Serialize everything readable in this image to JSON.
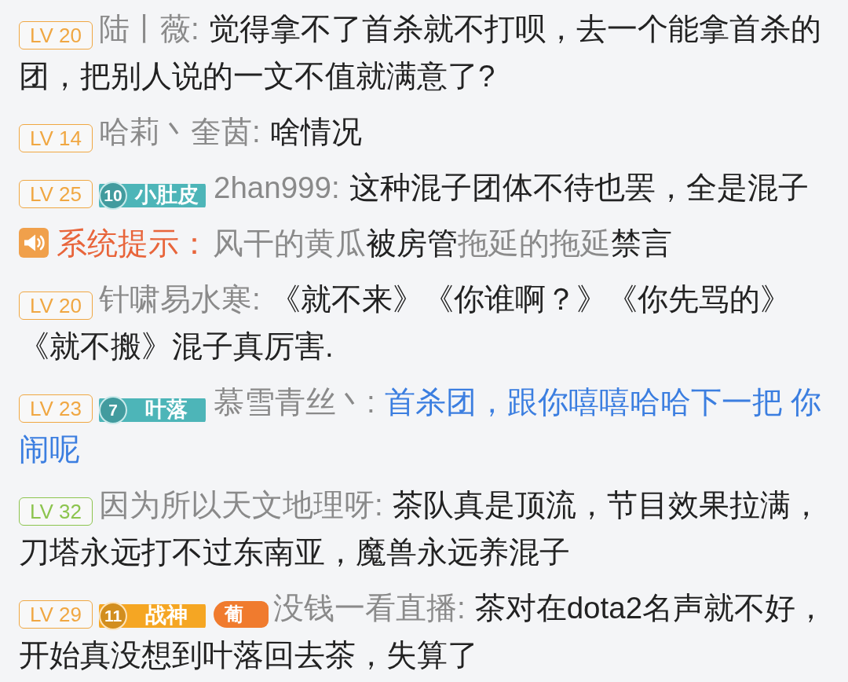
{
  "messages": [
    {
      "kind": "chat",
      "level": {
        "text": "LV 20",
        "color": "#f0a742"
      },
      "user": "陆丨薇:",
      "text": "觉得拿不了首杀就不打呗，去一个能拿首杀的团，把别人说的一文不值就满意了?"
    },
    {
      "kind": "chat",
      "level": {
        "text": "LV 14",
        "color": "#f0a742"
      },
      "user": "哈莉丶奎茵:",
      "text": "啥情况"
    },
    {
      "kind": "chat",
      "level": {
        "text": "LV 25",
        "color": "#f0a742"
      },
      "medal": {
        "number": "10",
        "name": "小肚皮",
        "color": "#4db5b8"
      },
      "user": "2han999:",
      "text": "这种混子团体不待也罢，全是混子"
    },
    {
      "kind": "system",
      "label": "系统提示：",
      "segments": [
        {
          "kind": "user",
          "text": "风干的黄瓜"
        },
        {
          "kind": "plain",
          "text": "被房管"
        },
        {
          "kind": "user",
          "text": "拖延的拖延"
        },
        {
          "kind": "plain",
          "text": "禁言"
        }
      ]
    },
    {
      "kind": "chat",
      "level": {
        "text": "LV 20",
        "color": "#f0a742"
      },
      "user": "针啸易水寒:",
      "text": "《就不来》《你谁啊？》《你先骂的》《就不搬》混子真厉害."
    },
    {
      "kind": "chat",
      "level": {
        "text": "LV 23",
        "color": "#f0a742"
      },
      "medal": {
        "number": "7",
        "name": "叶落",
        "color": "#4db5b8"
      },
      "user": "慕雪青丝丶:",
      "text": "首杀团，跟你嘻嘻哈哈下一把 你闹呢",
      "color": "#3b7ee0"
    },
    {
      "kind": "chat",
      "level": {
        "text": "LV 32",
        "color": "#8cc44e"
      },
      "user": "因为所以天文地理呀:",
      "text": "茶队真是顶流，节目效果拉满，刀塔永远打不过东南亚，魔兽永远养混子"
    },
    {
      "kind": "chat",
      "level": {
        "text": "LV 29",
        "color": "#f0a742"
      },
      "medal": {
        "number": "11",
        "name": "战神",
        "color": "#f5a623"
      },
      "tag": {
        "text": "葡",
        "color": "#f07b2e"
      },
      "user": "没钱一看直播:",
      "text": "茶对在dota2名声就不好，开始真没想到叶落回去茶，失算了"
    }
  ]
}
